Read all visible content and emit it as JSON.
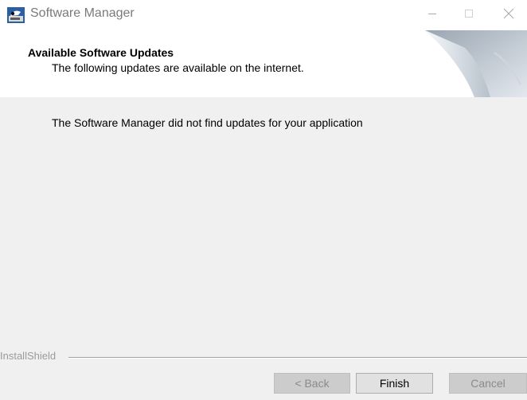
{
  "window": {
    "title": "Software Manager",
    "app_icon": "installer-icon",
    "controls": {
      "minimize_icon": "minimize-icon",
      "maximize_icon": "maximize-icon",
      "close_icon": "close-icon"
    }
  },
  "header": {
    "title": "Available Software Updates",
    "subtitle": "The following updates are available on the internet.",
    "graphic": "page-curl-graphic"
  },
  "body": {
    "message": "The Software Manager did not find updates for your application"
  },
  "footer": {
    "brand": "InstallShield",
    "buttons": {
      "back": "< Back",
      "finish": "Finish",
      "cancel": "Cancel"
    }
  },
  "colors": {
    "title_text": "#7a7a7a",
    "dialog_background": "#f0f0f0",
    "header_background": "#ffffff",
    "disabled_text": "#8a8a8a",
    "brand_text": "#9b9b9b"
  }
}
